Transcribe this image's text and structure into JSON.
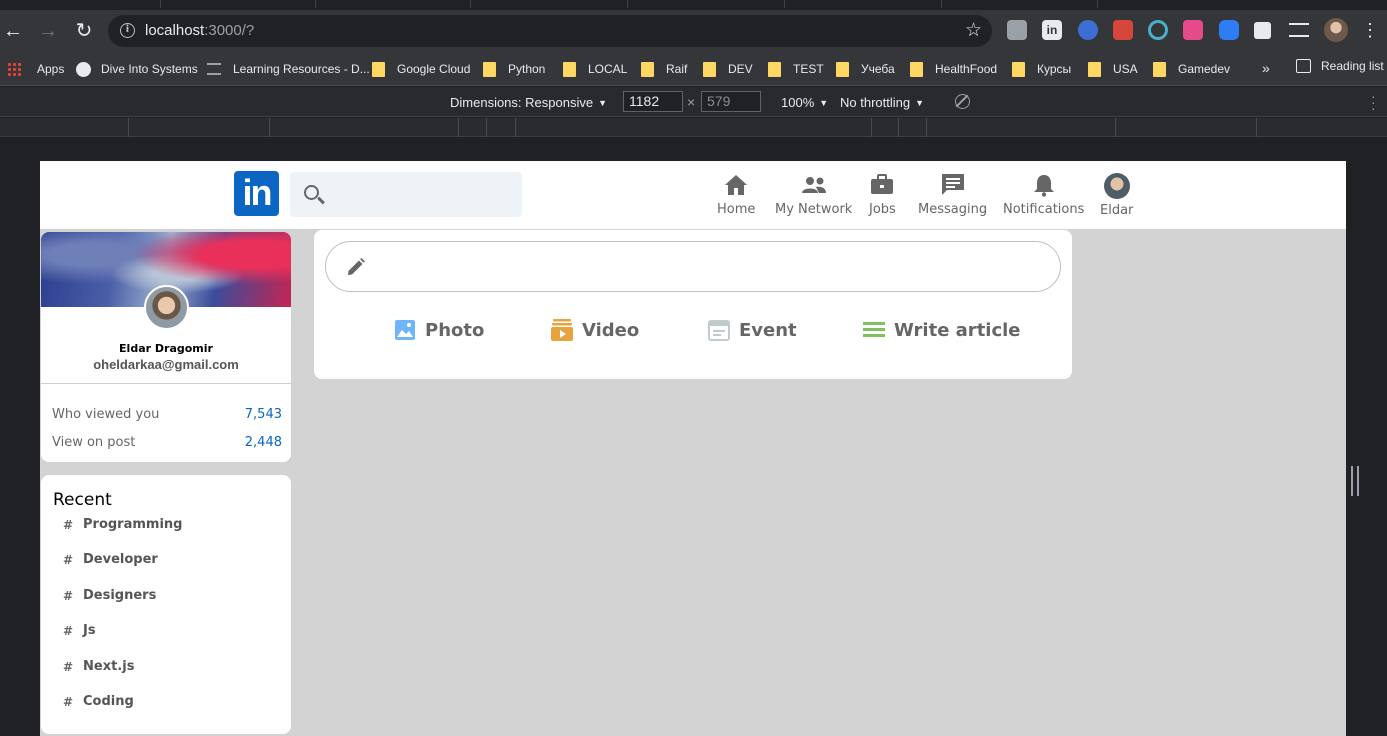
{
  "browser": {
    "url_host": "localhost",
    "url_rest": ":3000/?",
    "bookmarks": [
      "Apps",
      "Dive Into Systems",
      "Learning Resources - D...",
      "Google Cloud",
      "Python",
      "LOCAL",
      "Raif",
      "DEV",
      "TEST",
      "Учеба",
      "HealthFood",
      "Курсы",
      "USA",
      "Gamedev"
    ],
    "more_bookmarks": "»",
    "reading_list": "Reading list"
  },
  "devtools": {
    "dimensions_label": "Dimensions: Responsive",
    "width": "1182",
    "height": "579",
    "zoom": "100%",
    "throttling": "No throttling"
  },
  "header": {
    "logo_text": "in",
    "search_placeholder": "",
    "nav": [
      {
        "label": "Home",
        "icon": "home-icon"
      },
      {
        "label": "My Network",
        "icon": "network-icon"
      },
      {
        "label": "Jobs",
        "icon": "briefcase-icon"
      },
      {
        "label": "Messaging",
        "icon": "chat-icon"
      },
      {
        "label": "Notifications",
        "icon": "bell-icon"
      },
      {
        "label": "Eldar",
        "icon": "avatar"
      }
    ]
  },
  "sidebar": {
    "name": "Eldar Dragomir",
    "email": "oheldarkaa@gmail.com",
    "stats": [
      {
        "label": "Who viewed you",
        "value": "7,543"
      },
      {
        "label": "View on post",
        "value": "2,448"
      }
    ],
    "recent_title": "Recent",
    "recent_items": [
      "Programming",
      "Developer",
      "Designers",
      "Js",
      "Next.js",
      "Coding"
    ]
  },
  "share_box": {
    "actions": [
      {
        "label": "Photo",
        "icon": "photo-icon",
        "color": "#70b5f9"
      },
      {
        "label": "Video",
        "icon": "video-icon",
        "color": "#e7a33e"
      },
      {
        "label": "Event",
        "icon": "calendar-icon",
        "color": "#c0cbcd"
      },
      {
        "label": "Write article",
        "icon": "article-icon",
        "color": "#7fc15e"
      }
    ]
  },
  "colors": {
    "brand": "#0a66c2",
    "page_bg": "#d3d3d3"
  }
}
